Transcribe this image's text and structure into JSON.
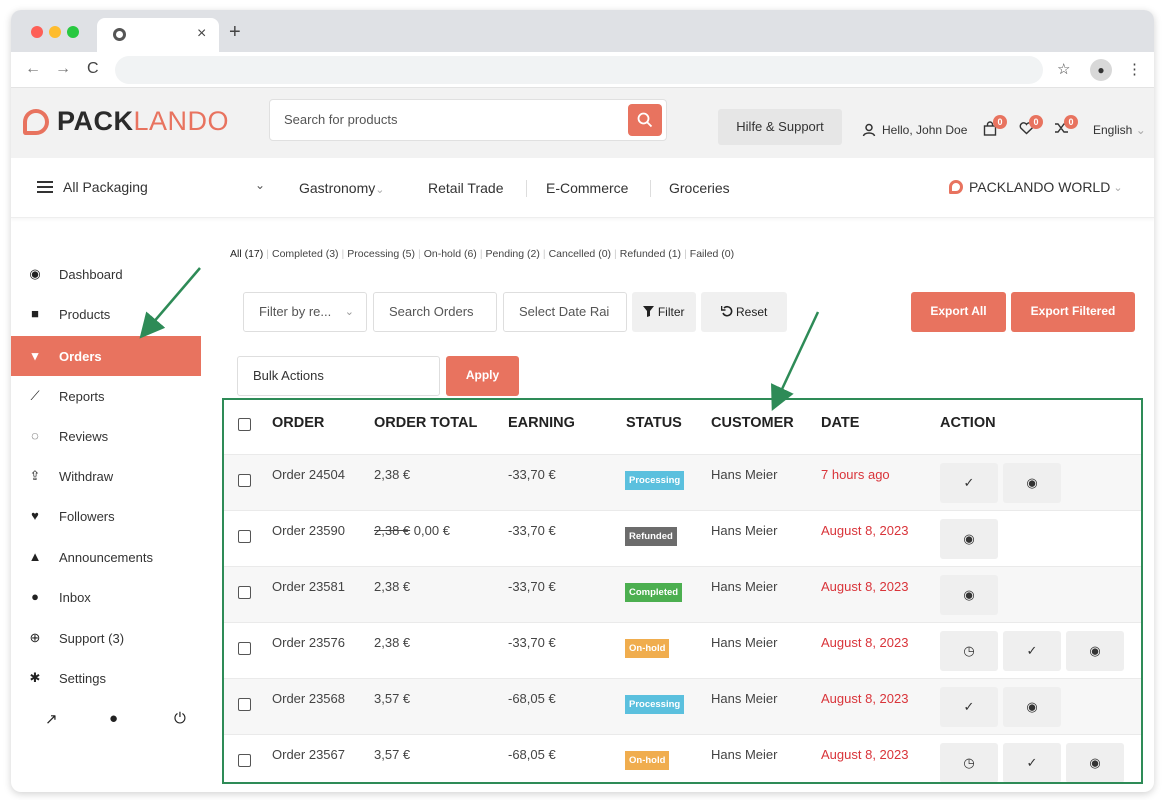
{
  "browser": {
    "tab_close": "×",
    "new_tab": "+",
    "nav_back": "←",
    "nav_forward": "→",
    "nav_reload": "C",
    "star": "☆",
    "menu": "⋮",
    "profile": "●"
  },
  "header": {
    "logo_bold": "PACK",
    "logo_light": "LANDO",
    "search_placeholder": "Search for products",
    "help_label": "Hilfe & Support",
    "hello_label": "Hello, John Doe",
    "cart_count": "0",
    "wishlist_count": "0",
    "compare_count": "0",
    "language": "English"
  },
  "catnav": {
    "all_label": "All Packaging",
    "chevron": "⌄",
    "categories": [
      "Gastronomy",
      "Retail Trade",
      "E-Commerce",
      "Groceries"
    ],
    "world_label": "PACKLANDO WORLD"
  },
  "sidebar": {
    "items": [
      {
        "label": "Dashboard",
        "icon": "dashboard-icon"
      },
      {
        "label": "Products",
        "icon": "briefcase-icon"
      },
      {
        "label": "Orders",
        "icon": "cart-icon"
      },
      {
        "label": "Reports",
        "icon": "chart-icon"
      },
      {
        "label": "Reviews",
        "icon": "comments-icon"
      },
      {
        "label": "Withdraw",
        "icon": "upload-icon"
      },
      {
        "label": "Followers",
        "icon": "heart-icon"
      },
      {
        "label": "Announcements",
        "icon": "bell-icon"
      },
      {
        "label": "Inbox",
        "icon": "comment-icon"
      },
      {
        "label": "Support (3)",
        "icon": "lifebuoy-icon"
      },
      {
        "label": "Settings",
        "icon": "cog-icon"
      }
    ],
    "active_index": 2
  },
  "order_filters": [
    "All (17)",
    "Completed (3)",
    "Processing (5)",
    "On-hold (6)",
    "Pending (2)",
    "Cancelled (0)",
    "Refunded (1)",
    "Failed (0)"
  ],
  "controls": {
    "filter_by": "Filter by re...",
    "search_orders": "Search Orders",
    "date_range": "Select Date Rai",
    "filter_btn": "Filter",
    "reset_btn": "Reset",
    "export_all": "Export All",
    "export_filtered": "Export Filtered",
    "bulk_actions": "Bulk Actions",
    "apply": "Apply"
  },
  "table": {
    "headers": [
      "ORDER",
      "ORDER TOTAL",
      "EARNING",
      "STATUS",
      "CUSTOMER",
      "DATE",
      "ACTION"
    ],
    "rows": [
      {
        "order": "Order 24504",
        "total_old": "",
        "total": "2,38 €",
        "earning": "-33,70 €",
        "status": "Processing",
        "customer": "Hans Meier",
        "date": "7 hours ago",
        "actions": [
          "check",
          "view"
        ]
      },
      {
        "order": "Order 23590",
        "total_old": "2,38 €",
        "total": "0,00 €",
        "earning": "-33,70 €",
        "status": "Refunded",
        "customer": "Hans Meier",
        "date": "August 8, 2023",
        "actions": [
          "view"
        ]
      },
      {
        "order": "Order 23581",
        "total_old": "",
        "total": "2,38 €",
        "earning": "-33,70 €",
        "status": "Completed",
        "customer": "Hans Meier",
        "date": "August 8, 2023",
        "actions": [
          "view"
        ]
      },
      {
        "order": "Order 23576",
        "total_old": "",
        "total": "2,38 €",
        "earning": "-33,70 €",
        "status": "On-hold",
        "customer": "Hans Meier",
        "date": "August 8, 2023",
        "actions": [
          "clock",
          "check",
          "view"
        ]
      },
      {
        "order": "Order 23568",
        "total_old": "",
        "total": "3,57 €",
        "earning": "-68,05 €",
        "status": "Processing",
        "customer": "Hans Meier",
        "date": "August 8, 2023",
        "actions": [
          "check",
          "view"
        ]
      },
      {
        "order": "Order 23567",
        "total_old": "",
        "total": "3,57 €",
        "earning": "-68,05 €",
        "status": "On-hold",
        "customer": "Hans Meier",
        "date": "August 8, 2023",
        "actions": [
          "clock",
          "check",
          "view"
        ]
      }
    ]
  },
  "colors": {
    "brand": "#e8735f",
    "annotation": "#2e8b57",
    "date": "#d9343a"
  }
}
